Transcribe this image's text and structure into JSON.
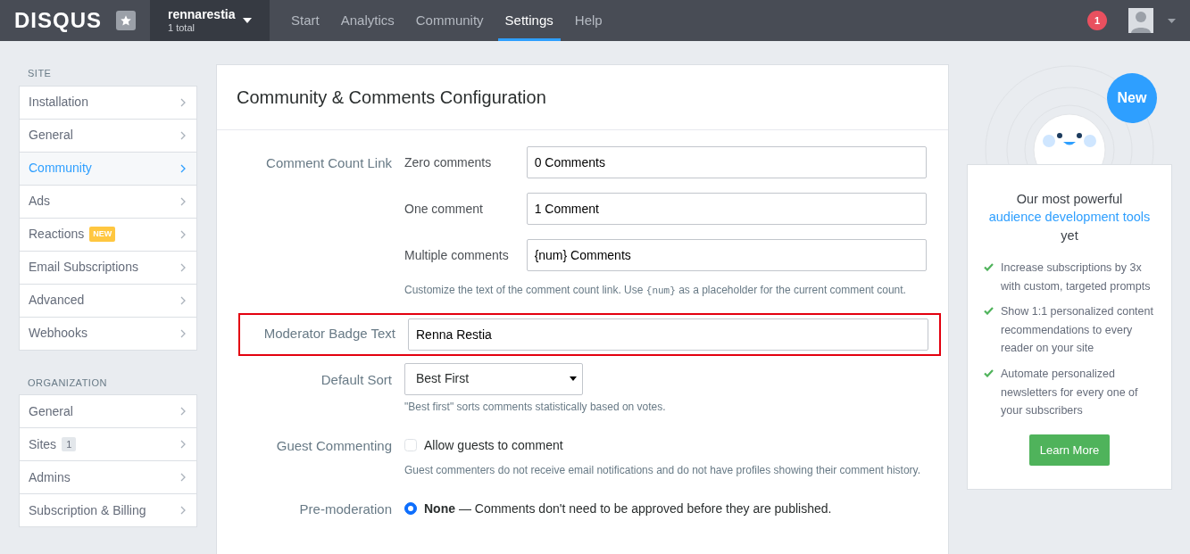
{
  "navbar": {
    "logo": "DISQUS",
    "site": {
      "name": "rennarestia",
      "count": "1 total"
    },
    "tabs": [
      {
        "label": "Start",
        "selected": false
      },
      {
        "label": "Analytics",
        "selected": false
      },
      {
        "label": "Community",
        "selected": false
      },
      {
        "label": "Settings",
        "selected": true
      },
      {
        "label": "Help",
        "selected": false
      }
    ],
    "notifications": "1"
  },
  "sidebar": {
    "sections": [
      {
        "title": "SITE",
        "items": [
          {
            "label": "Installation",
            "selected": false
          },
          {
            "label": "General",
            "selected": false
          },
          {
            "label": "Community",
            "selected": true
          },
          {
            "label": "Ads",
            "selected": false
          },
          {
            "label": "Reactions",
            "selected": false,
            "tag": "NEW",
            "kind": "new"
          },
          {
            "label": "Email Subscriptions",
            "selected": false
          },
          {
            "label": "Advanced",
            "selected": false
          },
          {
            "label": "Webhooks",
            "selected": false
          }
        ]
      },
      {
        "title": "ORGANIZATION",
        "items": [
          {
            "label": "General",
            "selected": false
          },
          {
            "label": "Sites",
            "selected": false,
            "tag": "1",
            "kind": "count"
          },
          {
            "label": "Admins",
            "selected": false
          },
          {
            "label": "Subscription & Billing",
            "selected": false
          }
        ]
      }
    ]
  },
  "main": {
    "title": "Community & Comments Configuration",
    "count_link": {
      "label": "Comment Count Link",
      "fields": [
        {
          "label": "Zero comments",
          "value": "0 Comments"
        },
        {
          "label": "One comment",
          "value": "1 Comment"
        },
        {
          "label": "Multiple comments",
          "value": "{num} Comments"
        }
      ],
      "help": {
        "before": "Customize the text of the comment count link. Use ",
        "code": "{num}",
        "after": " as a placeholder for the current comment count."
      }
    },
    "moderator_badge": {
      "label": "Moderator Badge Text",
      "value": "Renna Restia",
      "highlighted": true
    },
    "default_sort": {
      "label": "Default Sort",
      "value": "Best First",
      "help": "\"Best first\" sorts comments statistically based on votes."
    },
    "guest": {
      "label": "Guest Commenting",
      "option": "Allow guests to comment",
      "checked": false,
      "help": "Guest commenters do not receive email notifications and do not have profiles showing their comment history."
    },
    "premoderation": {
      "label": "Pre-moderation",
      "option": "**None** — Comments don't need to be approved before they are published.",
      "selected": true
    }
  },
  "promo": {
    "bubble": "New",
    "before": "Our most powerful ",
    "link": "audience development tools",
    "after": " yet",
    "features": [
      "Increase subscriptions by 3x with custom, targeted prompts",
      "Show 1:1 personalized content recommendations to every reader on your site",
      "Automate personalized newsletters for every one of your subscribers"
    ],
    "button": "Learn More"
  }
}
